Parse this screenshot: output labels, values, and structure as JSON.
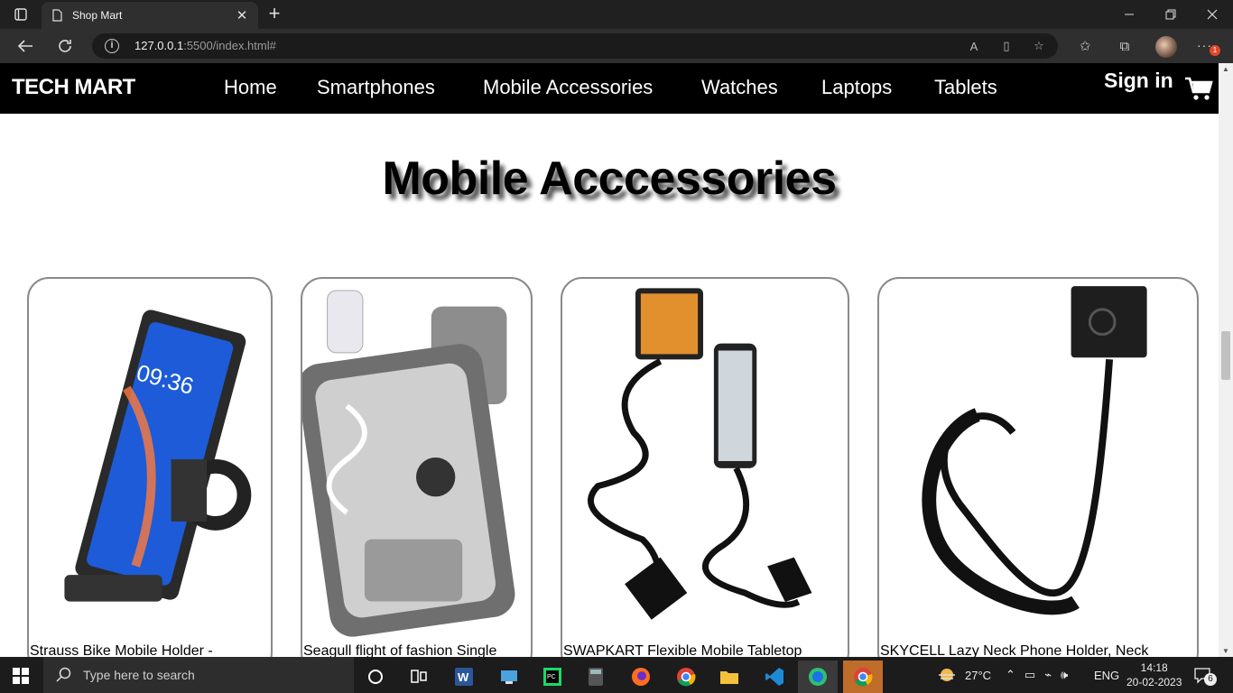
{
  "browser": {
    "tab_title": "Shop Mart",
    "url_host": "127.0.0.1",
    "url_rest": ":5500/index.html#",
    "notification_count": "1"
  },
  "site": {
    "brand": "TECH MART",
    "nav": [
      "Home",
      "Smartphones",
      "Mobile Accessories",
      "Watches",
      "Laptops",
      "Tablets"
    ],
    "signin": "Sign in",
    "section_title": "Mobile Acccessories",
    "products": [
      {
        "name": "Strauss Bike Mobile Holder -"
      },
      {
        "name": "Seagull flight of fashion Single"
      },
      {
        "name": "SWAPKART Flexible Mobile Tabletop"
      },
      {
        "name": "SKYCELL Lazy Neck Phone Holder, Neck"
      }
    ]
  },
  "taskbar": {
    "search_placeholder": "Type here to search",
    "temperature": "27°C",
    "language": "ENG",
    "time": "14:18",
    "date": "20-02-2023",
    "notifications": "6"
  }
}
